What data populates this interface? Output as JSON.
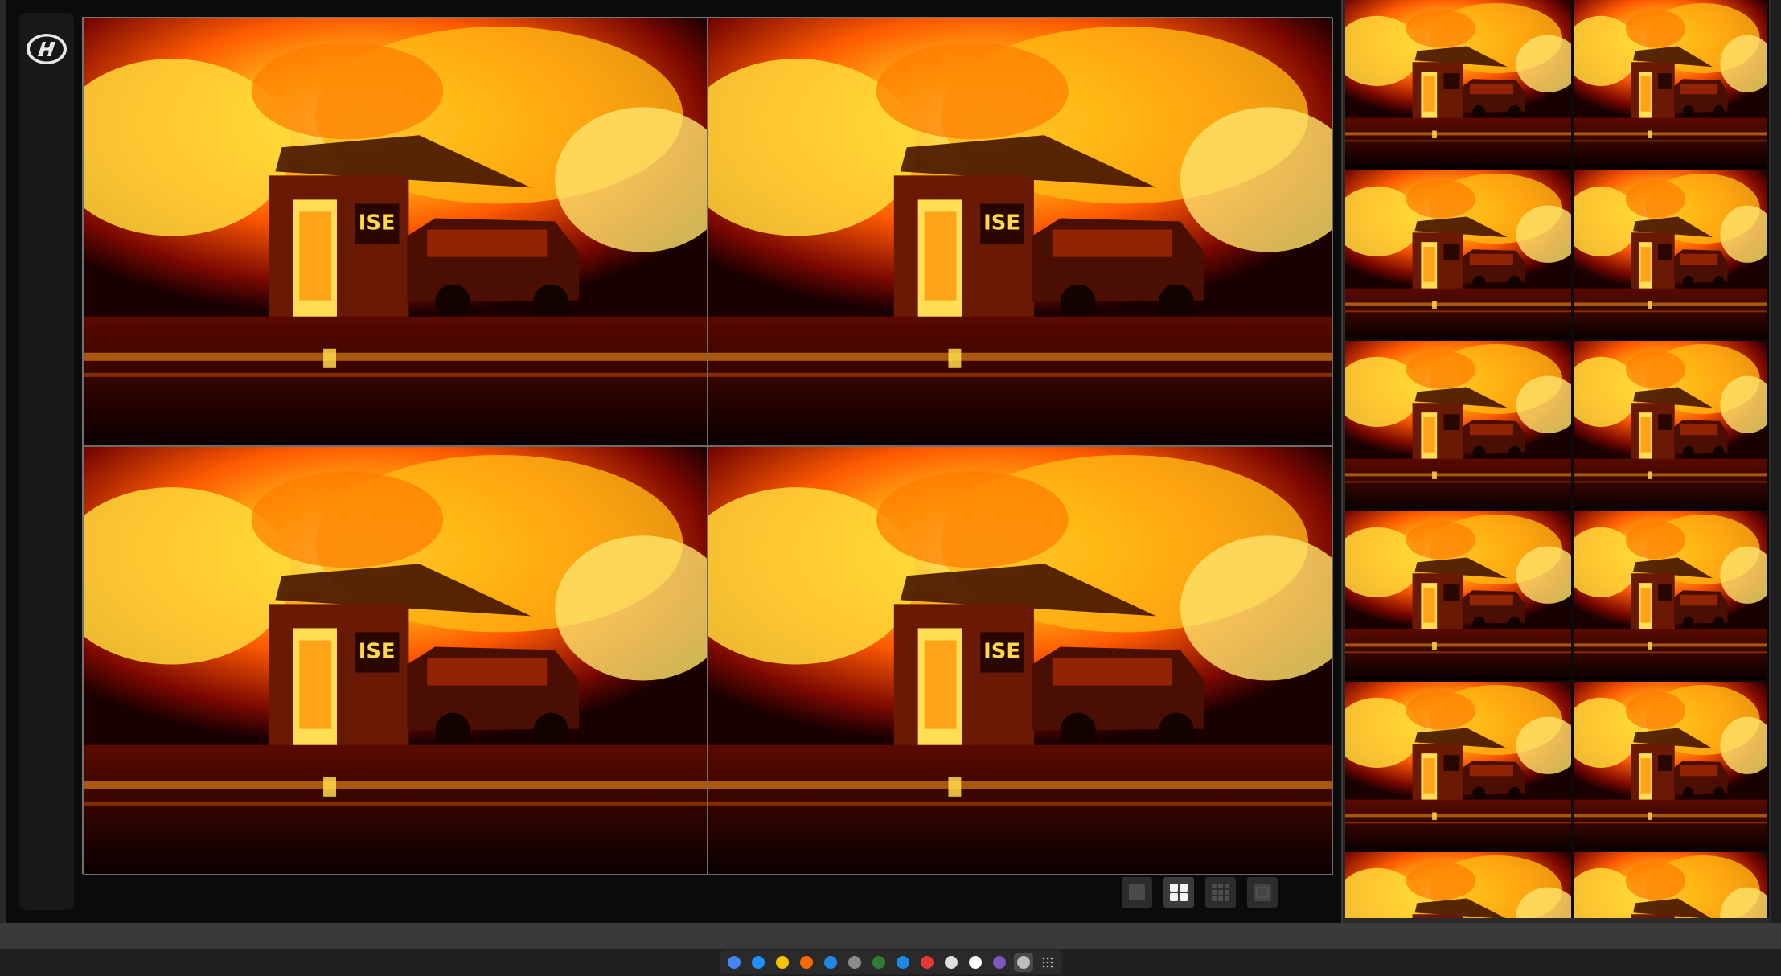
{
  "app": {
    "brand_icon": "hyundai-logo-icon",
    "accent": "#ff6a00"
  },
  "main_view": {
    "layout": "2x2",
    "cameras": [
      {
        "id": "cam-1",
        "overlay_text": "ISE"
      },
      {
        "id": "cam-2",
        "overlay_text": "ISE"
      },
      {
        "id": "cam-3",
        "overlay_text": "ISE"
      },
      {
        "id": "cam-4",
        "overlay_text": "ISE"
      }
    ]
  },
  "layout_buttons": [
    {
      "icon": "single-view-icon",
      "active": false
    },
    {
      "icon": "quad-view-icon",
      "active": true
    },
    {
      "icon": "nine-view-icon",
      "active": false
    },
    {
      "icon": "sixteen-view-icon",
      "active": false
    }
  ],
  "thumbnails": {
    "count": 12
  },
  "taskbar": {
    "icons": [
      {
        "name": "chrome-icon",
        "color": "#4285f4"
      },
      {
        "name": "edge-icon",
        "color": "#1e90ff"
      },
      {
        "name": "camera-app-icon",
        "color": "#f5c400"
      },
      {
        "name": "office-icon",
        "color": "#ff6a00"
      },
      {
        "name": "help-icon",
        "color": "#1e88e5"
      },
      {
        "name": "files-icon",
        "color": "#8b8b8b"
      },
      {
        "name": "sheets-icon",
        "color": "#2e7d32"
      },
      {
        "name": "onedrive-icon",
        "color": "#1e88e5"
      },
      {
        "name": "media-icon",
        "color": "#e53935"
      },
      {
        "name": "docs-icon",
        "color": "#e0e0e0"
      },
      {
        "name": "notion-icon",
        "color": "#ffffff"
      },
      {
        "name": "screen-capture-icon",
        "color": "#7e57c2"
      },
      {
        "name": "settings-icon",
        "color": "#bdbdbd"
      },
      {
        "name": "app-grid-icon",
        "color": "#bdbdbd"
      }
    ]
  }
}
